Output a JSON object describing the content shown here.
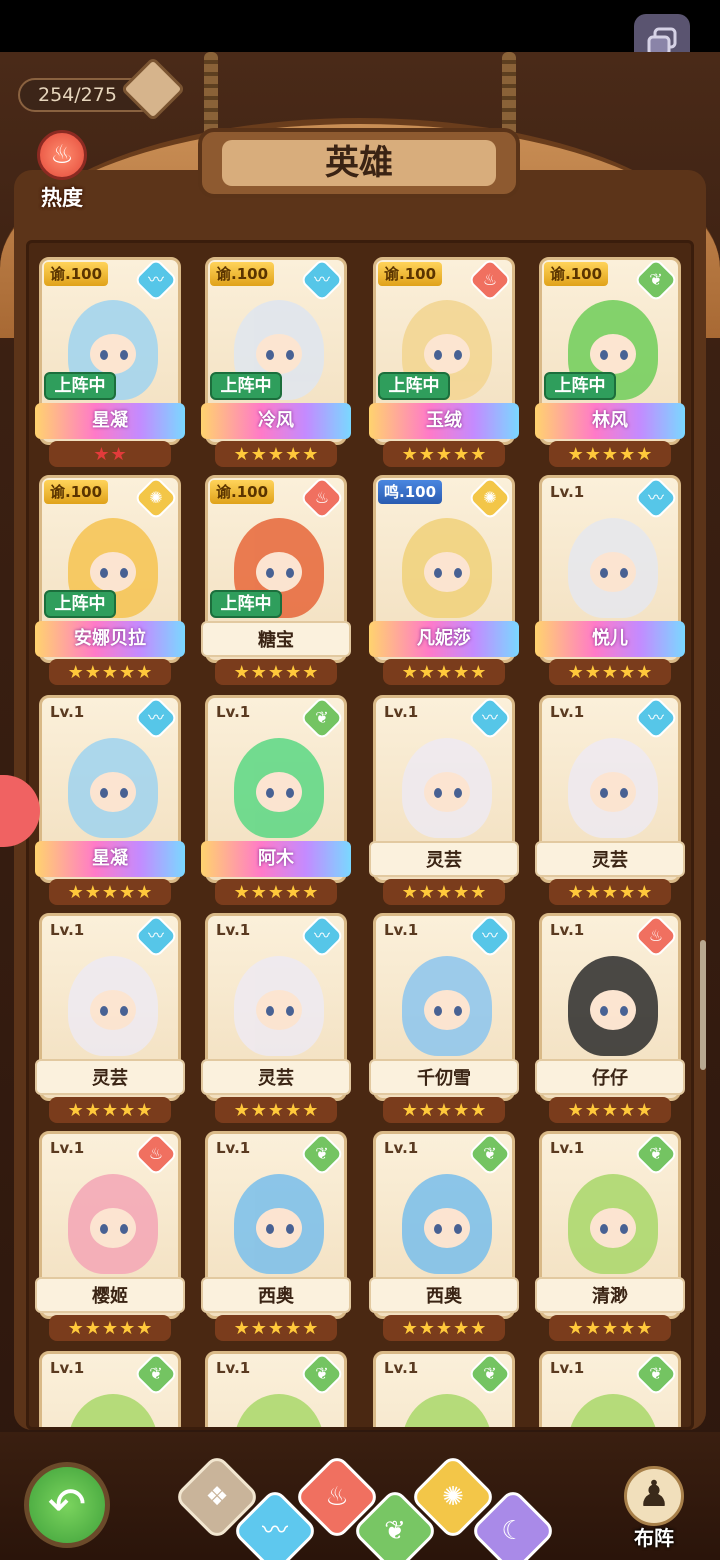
{
  "header": {
    "counter": "254/275",
    "title": "英雄",
    "heat_label": "热度"
  },
  "heroes": [
    {
      "level": "谕.100",
      "level_style": "gold",
      "element": "water",
      "status": "上阵中",
      "name": "星凝",
      "ribbon": "rainbow",
      "stars": "★★",
      "star_color": "red",
      "hair": "#9fd4f0"
    },
    {
      "level": "谕.100",
      "level_style": "gold",
      "element": "water",
      "status": "上阵中",
      "name": "冷风",
      "ribbon": "rainbow",
      "stars": "★★★★★",
      "star_color": "gold",
      "hair": "#dfe6f0"
    },
    {
      "level": "谕.100",
      "level_style": "gold",
      "element": "fire",
      "status": "上阵中",
      "name": "玉绒",
      "ribbon": "rainbow",
      "stars": "★★★★★",
      "star_color": "gold",
      "hair": "#f3d590"
    },
    {
      "level": "谕.100",
      "level_style": "gold",
      "element": "wood",
      "status": "上阵中",
      "name": "林风",
      "ribbon": "rainbow",
      "stars": "★★★★★",
      "star_color": "gold",
      "hair": "#6fce5a"
    },
    {
      "level": "谕.100",
      "level_style": "gold",
      "element": "light",
      "status": "上阵中",
      "name": "安娜贝拉",
      "ribbon": "rainbow",
      "stars": "★★★★★",
      "star_color": "gold",
      "hair": "#f6c451"
    },
    {
      "level": "谕.100",
      "level_style": "gold",
      "element": "fire",
      "status": "上阵中",
      "name": "糖宝",
      "ribbon": "plain",
      "stars": "★★★★★",
      "star_color": "gold",
      "hair": "#e7673a"
    },
    {
      "level": "鸣.100",
      "level_style": "blue",
      "element": "light",
      "status": "",
      "name": "凡妮莎",
      "ribbon": "rainbow",
      "stars": "★★★★★",
      "star_color": "gold",
      "hair": "#f1d27a"
    },
    {
      "level": "Lv.1",
      "level_style": "plain",
      "element": "water",
      "status": "",
      "name": "悦儿",
      "ribbon": "rainbow",
      "stars": "★★★★★",
      "star_color": "gold",
      "hair": "#e6e8ef"
    },
    {
      "level": "Lv.1",
      "level_style": "plain",
      "element": "water",
      "status": "",
      "name": "星凝",
      "ribbon": "rainbow",
      "stars": "★★★★★",
      "star_color": "gold",
      "hair": "#9fd4f0"
    },
    {
      "level": "Lv.1",
      "level_style": "plain",
      "element": "wood",
      "status": "",
      "name": "阿木",
      "ribbon": "rainbow",
      "stars": "★★★★★",
      "star_color": "gold",
      "hair": "#5bd884"
    },
    {
      "level": "Lv.1",
      "level_style": "plain",
      "element": "water",
      "status": "",
      "name": "灵芸",
      "ribbon": "plain",
      "stars": "★★★★★",
      "star_color": "gold",
      "hair": "#eeeaf2"
    },
    {
      "level": "Lv.1",
      "level_style": "plain",
      "element": "water",
      "status": "",
      "name": "灵芸",
      "ribbon": "plain",
      "stars": "★★★★★",
      "star_color": "gold",
      "hair": "#eeeaf2"
    },
    {
      "level": "Lv.1",
      "level_style": "plain",
      "element": "water",
      "status": "",
      "name": "灵芸",
      "ribbon": "plain",
      "stars": "★★★★★",
      "star_color": "gold",
      "hair": "#eeeaf2"
    },
    {
      "level": "Lv.1",
      "level_style": "plain",
      "element": "water",
      "status": "",
      "name": "灵芸",
      "ribbon": "plain",
      "stars": "★★★★★",
      "star_color": "gold",
      "hair": "#eeeaf2"
    },
    {
      "level": "Lv.1",
      "level_style": "plain",
      "element": "water",
      "status": "",
      "name": "千仞雪",
      "ribbon": "plain",
      "stars": "★★★★★",
      "star_color": "gold",
      "hair": "#8cc6ef"
    },
    {
      "level": "Lv.1",
      "level_style": "plain",
      "element": "fire",
      "status": "",
      "name": "仔仔",
      "ribbon": "plain",
      "stars": "★★★★★",
      "star_color": "gold",
      "hair": "#2c2c2c"
    },
    {
      "level": "Lv.1",
      "level_style": "plain",
      "element": "fire",
      "status": "",
      "name": "樱姬",
      "ribbon": "plain",
      "stars": "★★★★★",
      "star_color": "gold",
      "hair": "#f4a6b6"
    },
    {
      "level": "Lv.1",
      "level_style": "plain",
      "element": "wood",
      "status": "",
      "name": "西奥",
      "ribbon": "plain",
      "stars": "★★★★★",
      "star_color": "gold",
      "hair": "#79bfec"
    },
    {
      "level": "Lv.1",
      "level_style": "plain",
      "element": "wood",
      "status": "",
      "name": "西奥",
      "ribbon": "plain",
      "stars": "★★★★★",
      "star_color": "gold",
      "hair": "#79bfec"
    },
    {
      "level": "Lv.1",
      "level_style": "plain",
      "element": "wood",
      "status": "",
      "name": "清渺",
      "ribbon": "plain",
      "stars": "★★★★★",
      "star_color": "gold",
      "hair": "#a9d86a"
    },
    {
      "level": "Lv.1",
      "level_style": "plain",
      "element": "wood",
      "status": "",
      "name": "",
      "ribbon": "none",
      "stars": "",
      "star_color": "gold",
      "hair": "#a9d86a"
    },
    {
      "level": "Lv.1",
      "level_style": "plain",
      "element": "wood",
      "status": "",
      "name": "",
      "ribbon": "none",
      "stars": "",
      "star_color": "gold",
      "hair": "#a9d86a"
    },
    {
      "level": "Lv.1",
      "level_style": "plain",
      "element": "wood",
      "status": "",
      "name": "",
      "ribbon": "none",
      "stars": "",
      "star_color": "gold",
      "hair": "#a9d86a"
    },
    {
      "level": "Lv.1",
      "level_style": "plain",
      "element": "wood",
      "status": "",
      "name": "",
      "ribbon": "none",
      "stars": "",
      "star_color": "gold",
      "hair": "#a9d86a"
    }
  ],
  "element_icons": {
    "water": "〰",
    "fire": "♨",
    "wood": "❦",
    "light": "✺",
    "all": "❖",
    "moon": "☾"
  },
  "filters": [
    {
      "id": "all",
      "icon": "❖"
    },
    {
      "id": "water",
      "icon": "〰"
    },
    {
      "id": "fire",
      "icon": "♨"
    },
    {
      "id": "wood",
      "icon": "❦"
    },
    {
      "id": "light",
      "icon": "✺"
    },
    {
      "id": "moon",
      "icon": "☾"
    }
  ],
  "bottom": {
    "back_icon": "↶",
    "lineup_icon": "♟",
    "lineup_label": "布阵"
  }
}
